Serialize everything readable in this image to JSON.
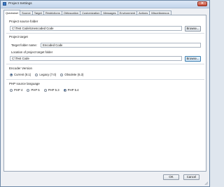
{
  "window": {
    "title": "Project Settings",
    "close_glyph": "✕"
  },
  "tabs": [
    {
      "label": "Quickstart",
      "active": true
    },
    {
      "label": "Source"
    },
    {
      "label": "Target"
    },
    {
      "label": "Restrictions"
    },
    {
      "label": "Obfuscation"
    },
    {
      "label": "Customization"
    },
    {
      "label": "Messages"
    },
    {
      "label": "Environment"
    },
    {
      "label": "Actions"
    },
    {
      "label": "Miscellaneous"
    }
  ],
  "source": {
    "title": "Project source folder",
    "path": "C:\\Test Code\\Unencoded Code",
    "browse_label": "Browse..."
  },
  "target": {
    "title": "Project target",
    "name_label": "Target folder name:",
    "name_value": "Encoded Code",
    "location_label": "Location of project target folder",
    "location_value": "C:\\Test Code",
    "browse_label": "Browse..."
  },
  "encoder": {
    "title": "Encoder Version",
    "options": [
      {
        "label": "Current (8.1)",
        "selected": true
      },
      {
        "label": "Legacy (7.0)",
        "selected": false
      },
      {
        "label": "Obsolete (6.3)",
        "selected": false
      }
    ]
  },
  "php": {
    "title": "PHP source language",
    "options": [
      {
        "label": "PHP 4",
        "selected": false
      },
      {
        "label": "PHP 5",
        "selected": false
      },
      {
        "label": "PHP 5.3",
        "selected": false
      },
      {
        "label": "PHP 5.4",
        "selected": true
      }
    ]
  },
  "footer": {
    "ok_label": "OK",
    "cancel_label": "Cancel"
  },
  "colors": {
    "accent": "#3c7fb1",
    "title_bar": "#c4d6ec",
    "close": "#c84a34"
  }
}
